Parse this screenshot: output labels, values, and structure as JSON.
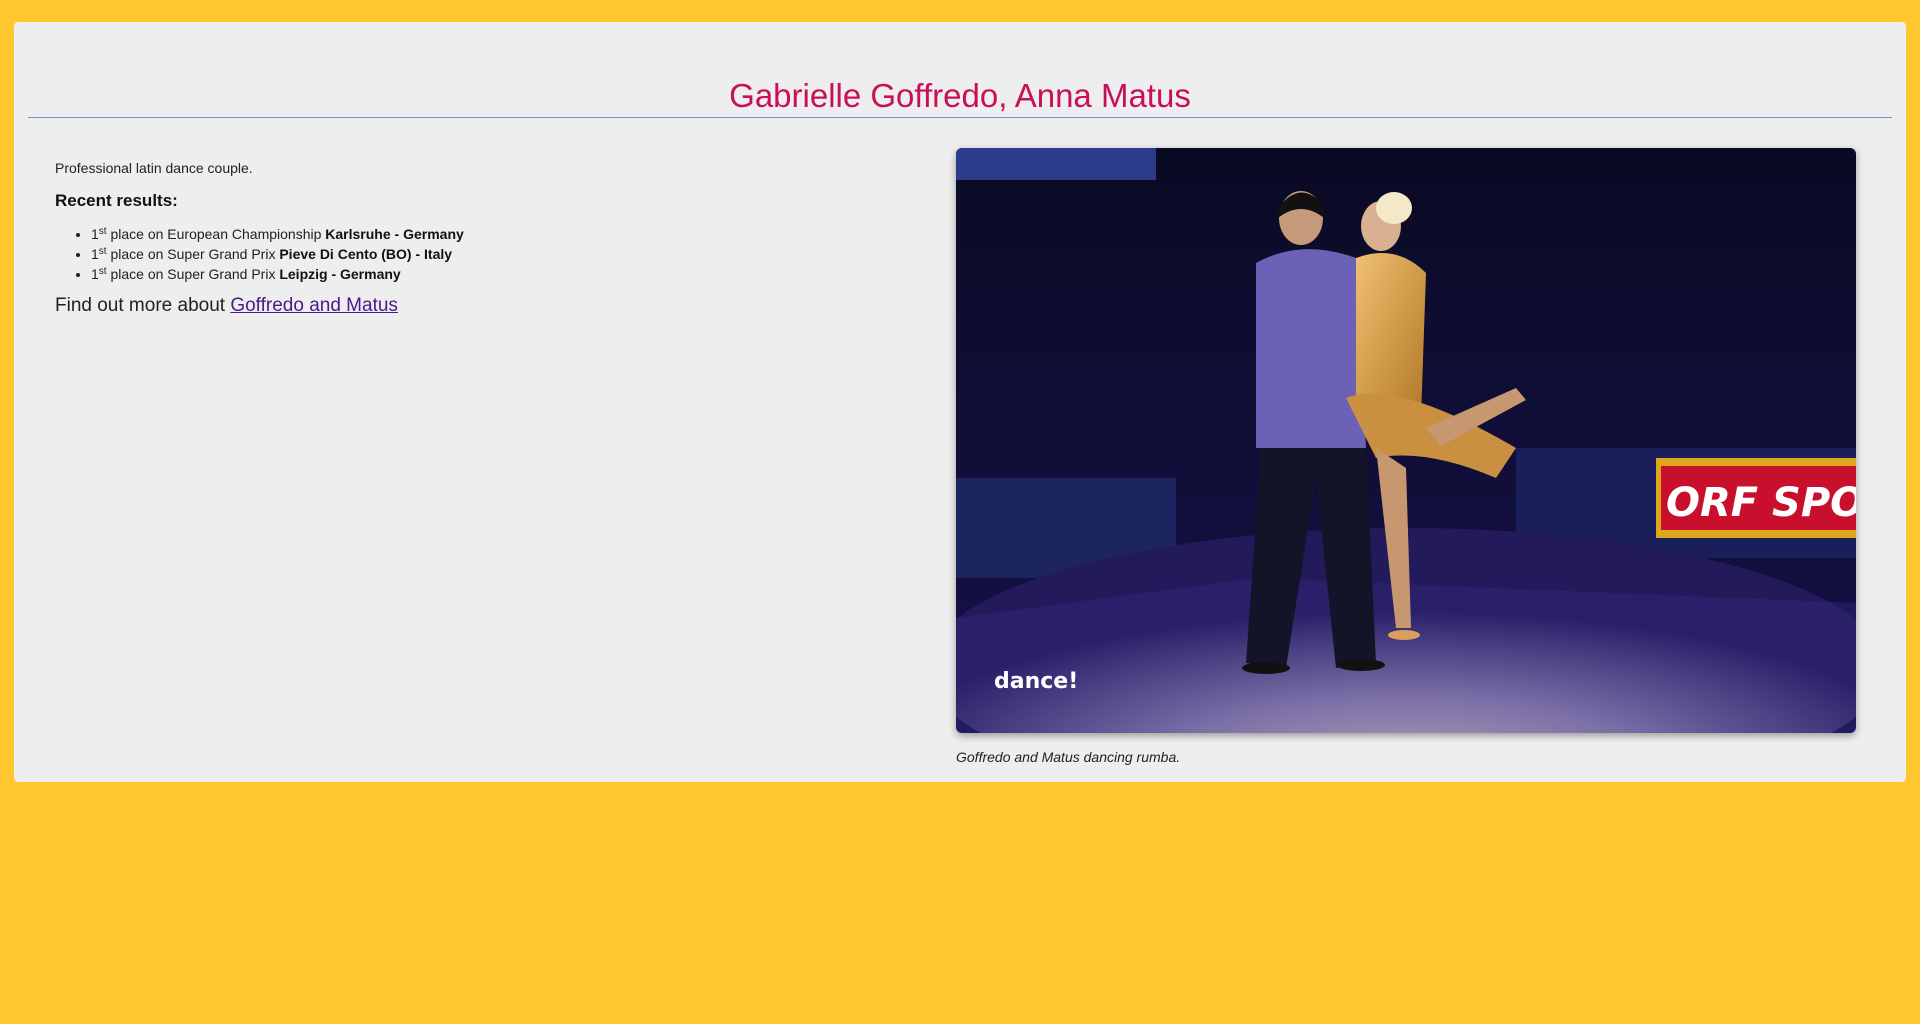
{
  "page": {
    "title": "Gabrielle Goffredo, Anna Matus",
    "intro": "Professional latin dance couple.",
    "results_heading": "Recent results:",
    "results": [
      {
        "place": "1",
        "suffix": "st",
        "text": " place on European Championship ",
        "location": "Karlsruhe - Germany"
      },
      {
        "place": "1",
        "suffix": "st",
        "text": " place on Super Grand Prix ",
        "location": "Pieve Di Cento (BO) - Italy"
      },
      {
        "place": "1",
        "suffix": "st",
        "text": " place on Super Grand Prix ",
        "location": "Leipzig - Germany"
      }
    ],
    "more_prefix": "Find out more about ",
    "more_link": "Goffredo and Matus",
    "photo_caption": "Goffredo and Matus dancing rumba.",
    "photo_watermark": "dance!",
    "photo_banner": "ORF SPO"
  },
  "colors": {
    "background": "#ffc62e",
    "card": "#eeeeee",
    "title": "#c8105a",
    "divider": "#6f8fcf",
    "link": "#4a1a8a"
  }
}
